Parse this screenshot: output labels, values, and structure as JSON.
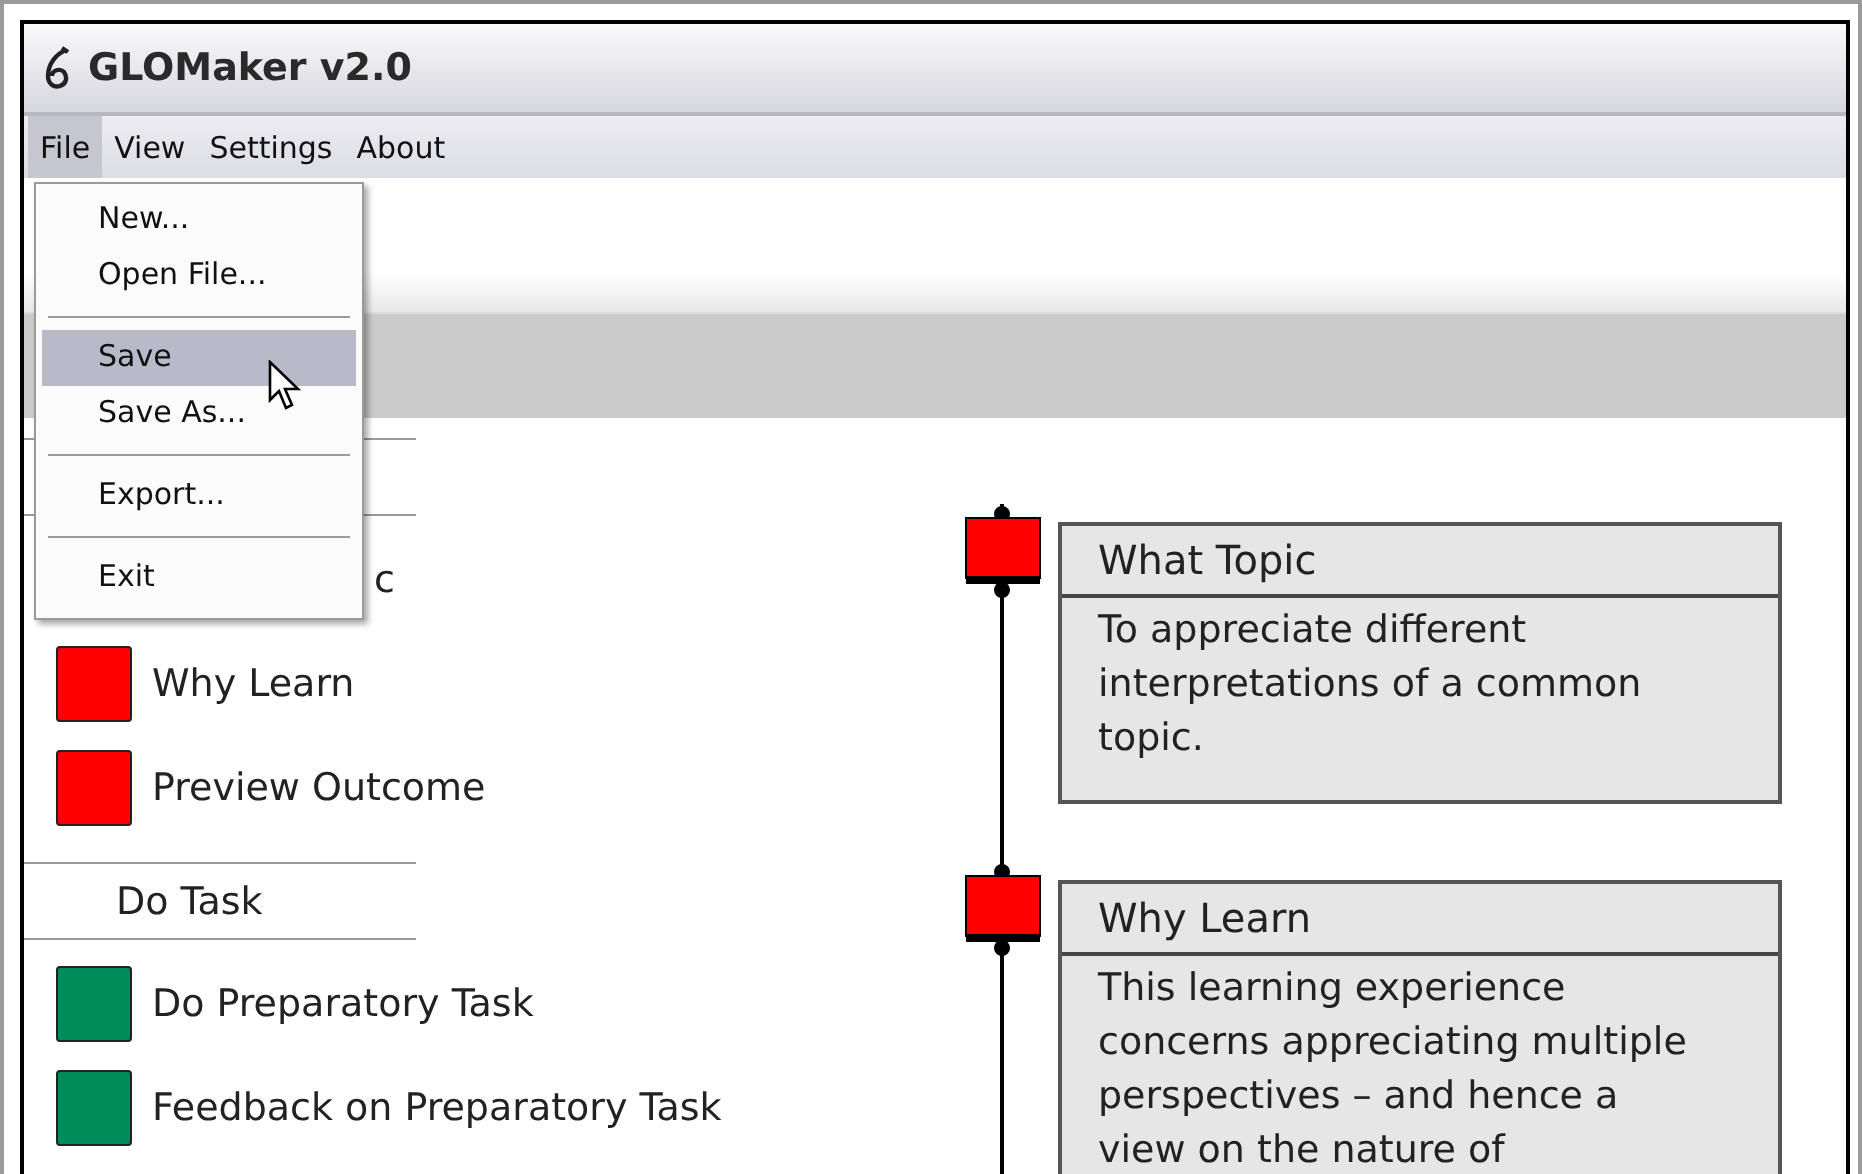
{
  "window": {
    "title": "GLOMaker v2.0"
  },
  "menu_bar": [
    {
      "label": "File",
      "selected": true
    },
    {
      "label": "View",
      "selected": false
    },
    {
      "label": "Settings",
      "selected": false
    },
    {
      "label": "About",
      "selected": false
    }
  ],
  "file_menu": {
    "items": [
      {
        "kind": "item",
        "label": "New...",
        "selected": false
      },
      {
        "kind": "item",
        "label": "Open File...",
        "selected": false
      },
      {
        "kind": "separator"
      },
      {
        "kind": "item",
        "label": "Save",
        "selected": true
      },
      {
        "kind": "item",
        "label": "Save As...",
        "selected": false
      },
      {
        "kind": "separator"
      },
      {
        "kind": "item",
        "label": "Export...",
        "selected": false
      },
      {
        "kind": "separator"
      },
      {
        "kind": "item",
        "label": "Exit",
        "selected": false
      }
    ]
  },
  "sidebar": {
    "items": [
      {
        "kind": "section"
      },
      {
        "kind": "partial-step",
        "label": "c"
      },
      {
        "kind": "step",
        "label": "Why Learn",
        "color": "#ff0000"
      },
      {
        "kind": "step",
        "label": "Preview Outcome",
        "color": "#ff0000"
      },
      {
        "kind": "section",
        "label": "Do Task"
      },
      {
        "kind": "step",
        "label": "Do Preparatory Task",
        "color": "#008c5a"
      },
      {
        "kind": "step",
        "label": "Feedback on Preparatory Task",
        "color": "#008c5a"
      }
    ]
  },
  "timeline": {
    "cards": [
      {
        "title": "What Topic",
        "body": "To appreciate different interpretations of a common topic.",
        "color": "#ff0000"
      },
      {
        "title": "Why Learn",
        "body": "This learning experience concerns appreciating multiple perspectives – and hence a view on the nature of",
        "color": "#ff0000"
      }
    ]
  }
}
